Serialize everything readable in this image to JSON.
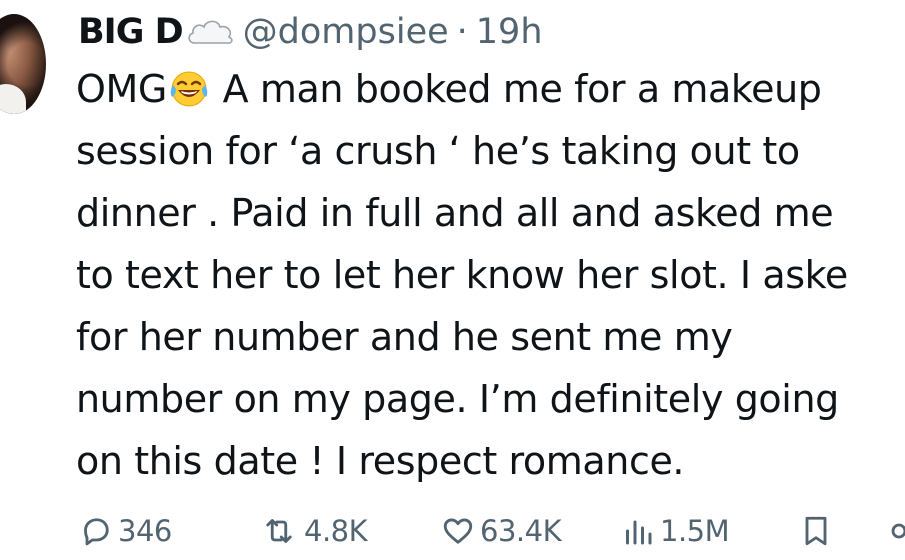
{
  "tweet": {
    "author_name": "BIG D",
    "author_emoji": "cloud",
    "handle": "@dompsiee",
    "separator": "·",
    "time": "19h",
    "text_lines": [
      {
        "pre": "OMG",
        "emoji": "face-with-tears-of-joy",
        "post": " A man booked me for a makeup"
      },
      {
        "text": "session for ‘a crush ‘ he’s taking out to"
      },
      {
        "text": "dinner . Paid in full and all and asked me"
      },
      {
        "text": "to text her to let her know her slot. I aske"
      },
      {
        "text": "for her number and he sent me my"
      },
      {
        "text": "number on my page. I’m definitely going"
      },
      {
        "text": "on this date ! I respect romance."
      }
    ]
  },
  "actions": {
    "replies": "346",
    "reposts": "4.8K",
    "likes": "63.4K",
    "views": "1.5M"
  },
  "colors": {
    "text": "#0f1419",
    "secondary": "#536471",
    "background": "#ffffff"
  }
}
